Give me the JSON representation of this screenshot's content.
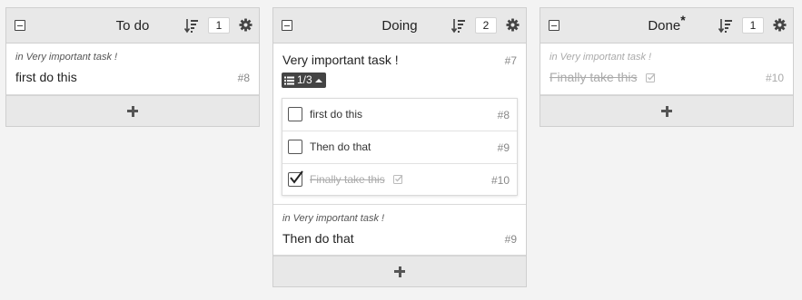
{
  "columns": [
    {
      "title": "To do",
      "count": "1",
      "tasks": [
        {
          "context": "in Very important task !",
          "title": "first do this",
          "id": "#8"
        }
      ]
    },
    {
      "title": "Doing",
      "count": "2",
      "tasks": [
        {
          "title": "Very important task !",
          "id": "#7",
          "subtasks_toggle": "1/3",
          "subtasks": [
            {
              "label": "first do this",
              "id": "#8",
              "checked": false
            },
            {
              "label": "Then do that",
              "id": "#9",
              "checked": false
            },
            {
              "label": "Finally take this",
              "id": "#10",
              "checked": true
            }
          ]
        },
        {
          "context": "in Very important task !",
          "title": "Then do that",
          "id": "#9"
        }
      ]
    },
    {
      "title": "Done",
      "title_marker": "*",
      "count": "1",
      "tasks": [
        {
          "context": "in Very important task !",
          "title": "Finally take this",
          "id": "#10",
          "done": true
        }
      ]
    }
  ],
  "colors": {
    "header_bg": "#e8e8e8",
    "page_bg": "#f3f3f3",
    "toggle_bg": "#444444",
    "muted_text": "#aaaaaa"
  },
  "icons": {
    "collapse": "collapse-icon",
    "sort": "sort-icon",
    "settings": "gear-icon",
    "add": "plus-icon",
    "list": "list-icon",
    "caret": "caret-up-icon",
    "done": "checked-square-icon"
  }
}
